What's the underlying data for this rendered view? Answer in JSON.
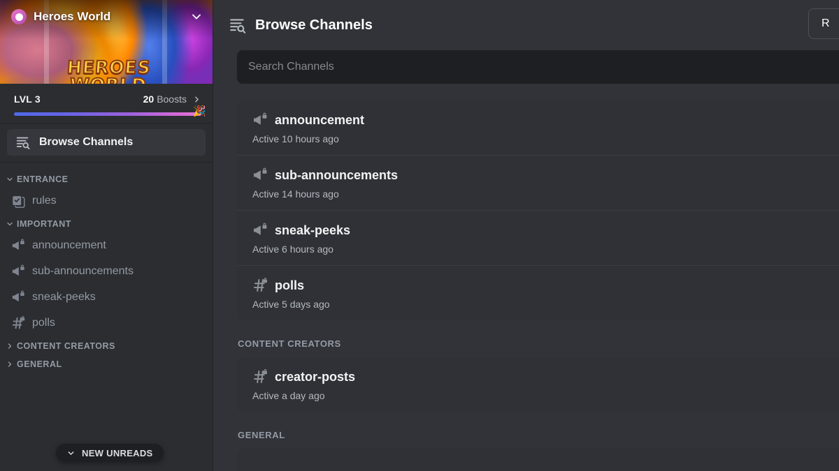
{
  "sidebar": {
    "server": {
      "name": "Heroes World",
      "badge_icon": "verified-shield-icon",
      "chevron_icon": "chevron-down-icon",
      "banner_text_line1": "HEROES",
      "banner_text_line2": "WORLD"
    },
    "boost": {
      "level_label": "LVL 3",
      "count": "20",
      "unit": "Boosts",
      "arrow_icon": "chevron-right-icon",
      "emoji": "🎉",
      "progress_percent": 97,
      "gradient_start": "#4f6ae8",
      "gradient_end": "#e07ad2"
    },
    "browse_button": {
      "label": "Browse Channels",
      "icon": "browse-channels-icon"
    },
    "categories": [
      {
        "label": "ENTRANCE",
        "expanded": true,
        "chevron_icon": "chevron-down-icon",
        "channels": [
          {
            "name": "rules",
            "icon": "rules-channel-icon"
          }
        ]
      },
      {
        "label": "IMPORTANT",
        "expanded": true,
        "chevron_icon": "chevron-down-icon",
        "channels": [
          {
            "name": "announcement",
            "icon": "announcement-locked-icon"
          },
          {
            "name": "sub-announcements",
            "icon": "announcement-locked-icon"
          },
          {
            "name": "sneak-peeks",
            "icon": "announcement-locked-icon"
          },
          {
            "name": "polls",
            "icon": "hash-locked-icon"
          }
        ]
      },
      {
        "label": "CONTENT CREATORS",
        "expanded": false,
        "chevron_icon": "chevron-right-icon",
        "channels": []
      },
      {
        "label": "GENERAL",
        "expanded": false,
        "chevron_icon": "chevron-right-icon",
        "channels": []
      }
    ],
    "new_unreads": {
      "label": "NEW UNREADS",
      "icon": "chevron-down-icon"
    }
  },
  "main": {
    "header": {
      "title": "Browse Channels",
      "icon": "browse-channels-icon"
    },
    "reset_button": {
      "label": "R"
    },
    "search": {
      "placeholder": "Search Channels",
      "value": ""
    },
    "sections": [
      {
        "header": "",
        "channels": [
          {
            "name": "announcement",
            "meta": "Active 10 hours ago",
            "icon": "announcement-locked-icon"
          },
          {
            "name": "sub-announcements",
            "meta": "Active 14 hours ago",
            "icon": "announcement-locked-icon"
          },
          {
            "name": "sneak-peeks",
            "meta": "Active 6 hours ago",
            "icon": "announcement-locked-icon"
          },
          {
            "name": "polls",
            "meta": "Active 5 days ago",
            "icon": "hash-locked-icon"
          }
        ]
      },
      {
        "header": "CONTENT CREATORS",
        "channels": [
          {
            "name": "creator-posts",
            "meta": "Active a day ago",
            "icon": "hash-locked-icon"
          }
        ]
      },
      {
        "header": "GENERAL",
        "channels": []
      }
    ]
  },
  "theme": {
    "sidebar_bg": "#2b2d31",
    "main_bg": "#313338",
    "card_bg": "#2f3136",
    "input_bg": "#1e1f22",
    "text_primary": "#f2f3f5",
    "text_muted": "#949ba4"
  }
}
